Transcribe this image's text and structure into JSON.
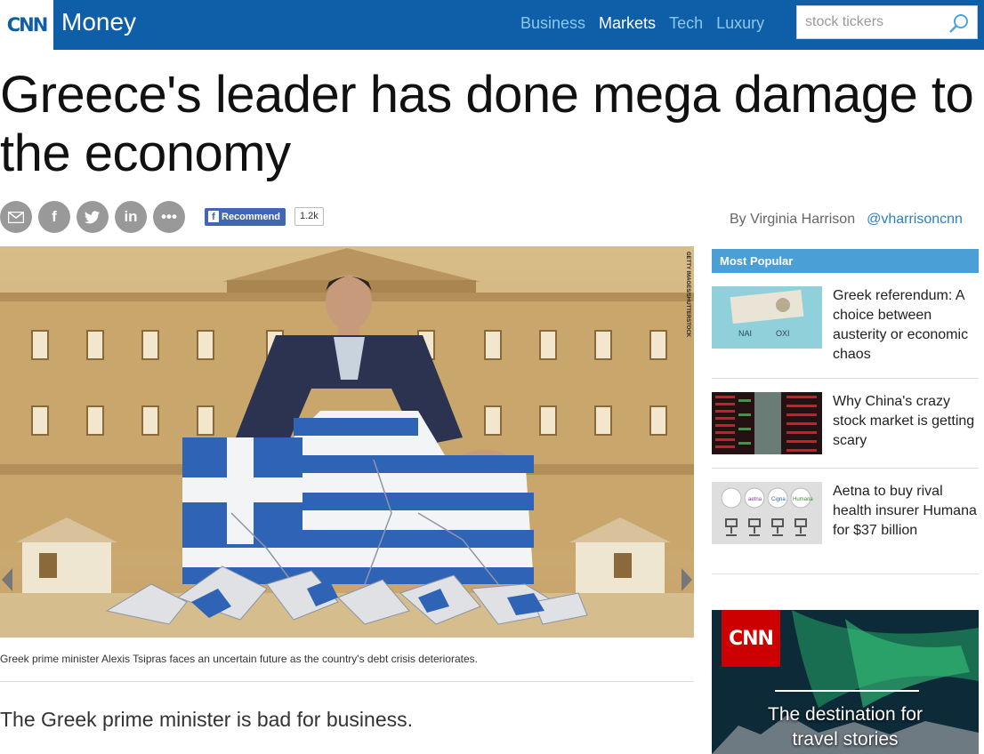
{
  "header": {
    "logo": "CNN",
    "brand": "Money",
    "nav": [
      {
        "label": "Business",
        "active": false
      },
      {
        "label": "Markets",
        "active": true
      },
      {
        "label": "Tech",
        "active": false
      },
      {
        "label": "Luxury",
        "active": false
      }
    ],
    "search_placeholder": "stock tickers",
    "search_icon": "search-icon"
  },
  "article": {
    "headline": "Greece's leader has done mega damage to the economy",
    "share_icons": [
      "email-icon",
      "facebook-icon",
      "twitter-icon",
      "linkedin-icon",
      "more-icon"
    ],
    "facebook_recommend": "Recommend",
    "facebook_count": "1.2k",
    "byline": "By Virginia Harrison",
    "twitter_handle": "@vharrisoncnn",
    "image_credit": "GETTY IMAGES/SHUTTERSTOCK",
    "caption": "Greek prime minister Alexis Tsipras faces an uncertain future as the country's debt crisis deteriorates.",
    "lede": "The Greek prime minister is bad for business."
  },
  "sidebar": {
    "most_popular_title": "Most Popular",
    "items": [
      {
        "title": "Greek referendum: A choice between austerity or economic chaos",
        "thumb_text_left": "NAI",
        "thumb_text_right": "OXI"
      },
      {
        "title": "Why China's crazy stock market is getting scary"
      },
      {
        "title": "Aetna to buy rival health insurer Humana for $37 billion",
        "thumb_labels": [
          "aetna",
          "Cigna",
          "Humana"
        ]
      }
    ]
  },
  "ad": {
    "logo": "CNN",
    "line1": "The destination for",
    "line2": "travel stories"
  },
  "colors": {
    "header_bg": "#0f5fa8",
    "nav_inactive": "#8cc8ee",
    "popular_header": "#4a9fd6",
    "link": "#2a7fc4"
  }
}
